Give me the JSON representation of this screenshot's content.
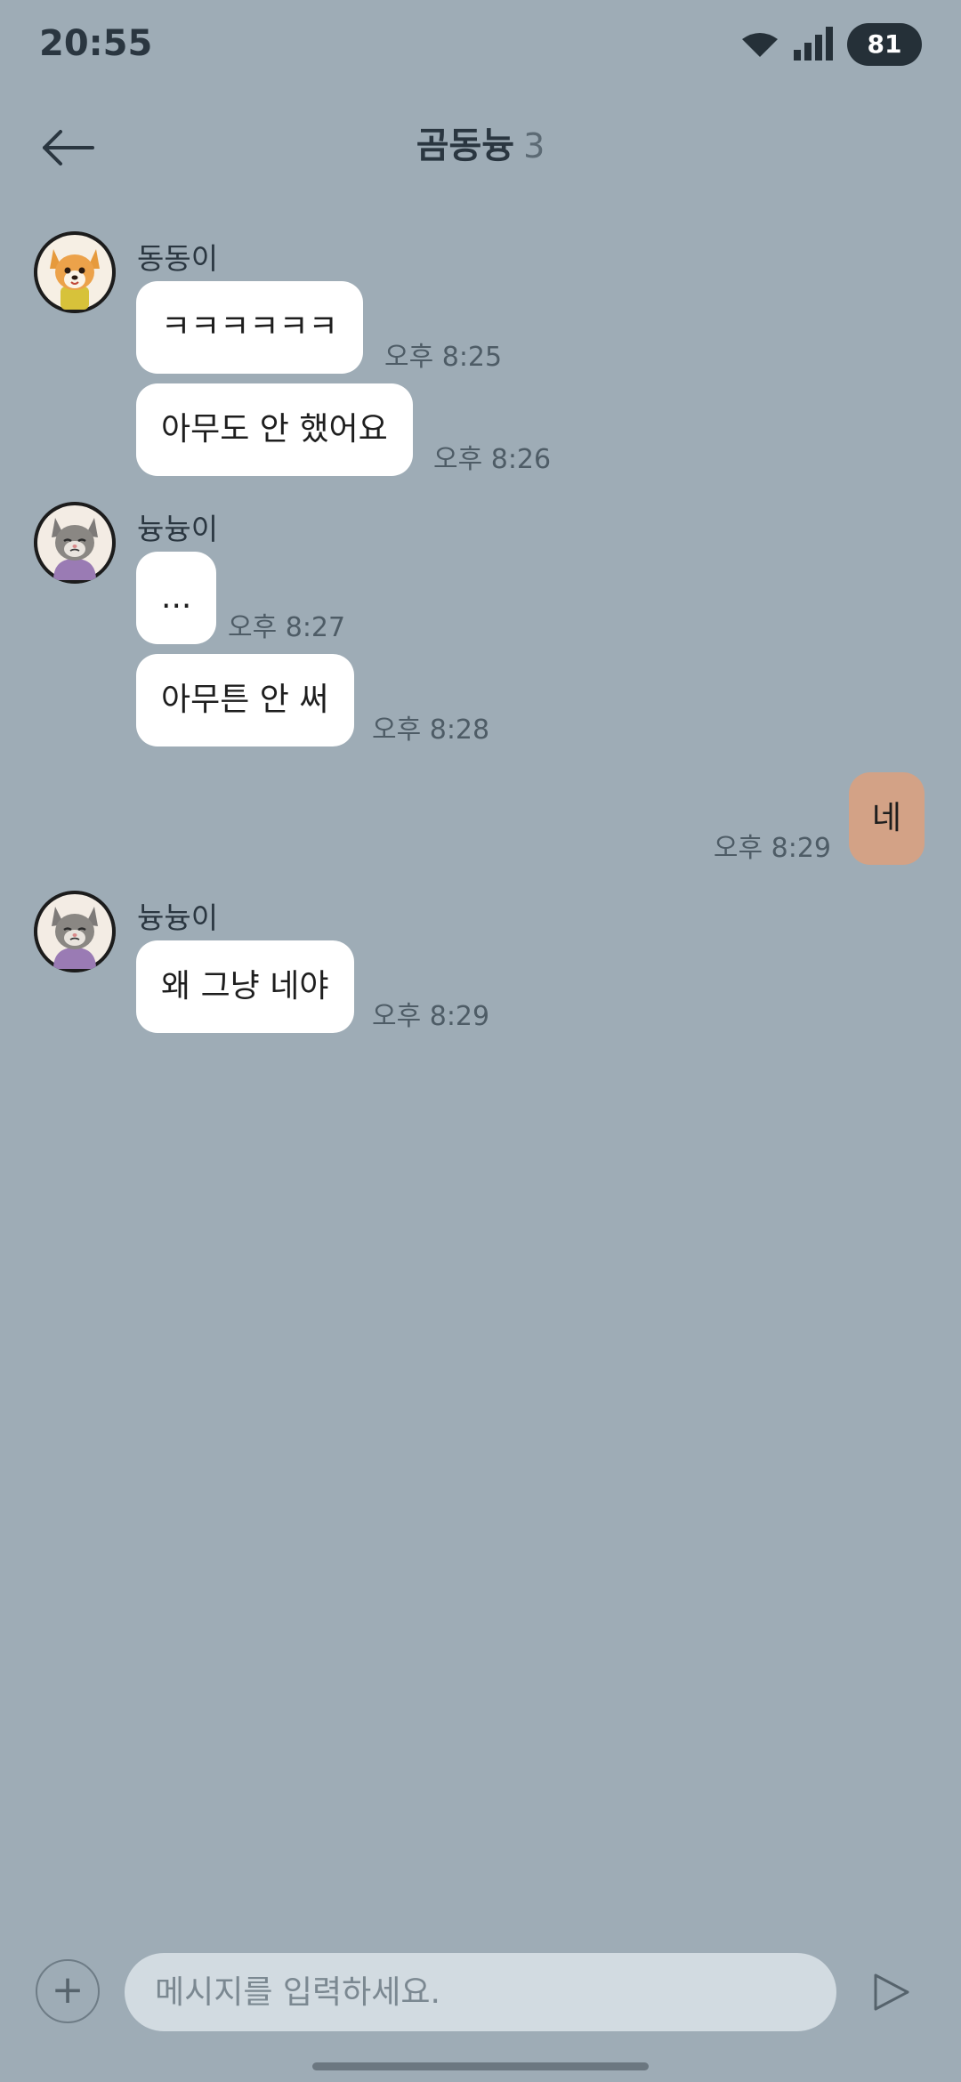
{
  "status_bar": {
    "time": "20:55",
    "battery": "81",
    "wifi_icon": "wifi-icon",
    "signal_icon": "cellular-signal-icon"
  },
  "header": {
    "back_icon": "back-arrow-icon",
    "title": "곰동늉",
    "member_count": "3"
  },
  "messages": [
    {
      "sender": "동동이",
      "text": "ㅋㅋㅋㅋㅋㅋ",
      "time": "오후 8:25"
    },
    {
      "sender": "동동이",
      "text": "아무도 안 했어요",
      "time": "오후 8:26"
    },
    {
      "sender": "늉늉이",
      "text": "...",
      "time": "오후 8:27"
    },
    {
      "sender": "늉늉이",
      "text": "아무튼 안 써",
      "time": "오후 8:28"
    },
    {
      "sender": "me",
      "text": "네",
      "time": "오후 8:29"
    },
    {
      "sender": "늉늉이",
      "text": "왜 그냥 네야",
      "time": "오후 8:29"
    }
  ],
  "input_bar": {
    "plus_label": "+",
    "placeholder": "메시지를 입력하세요.",
    "send_icon": "send-icon"
  },
  "colors": {
    "background": "#9eacb6",
    "my_bubble": "#d3a286",
    "other_bubble": "#ffffff"
  }
}
